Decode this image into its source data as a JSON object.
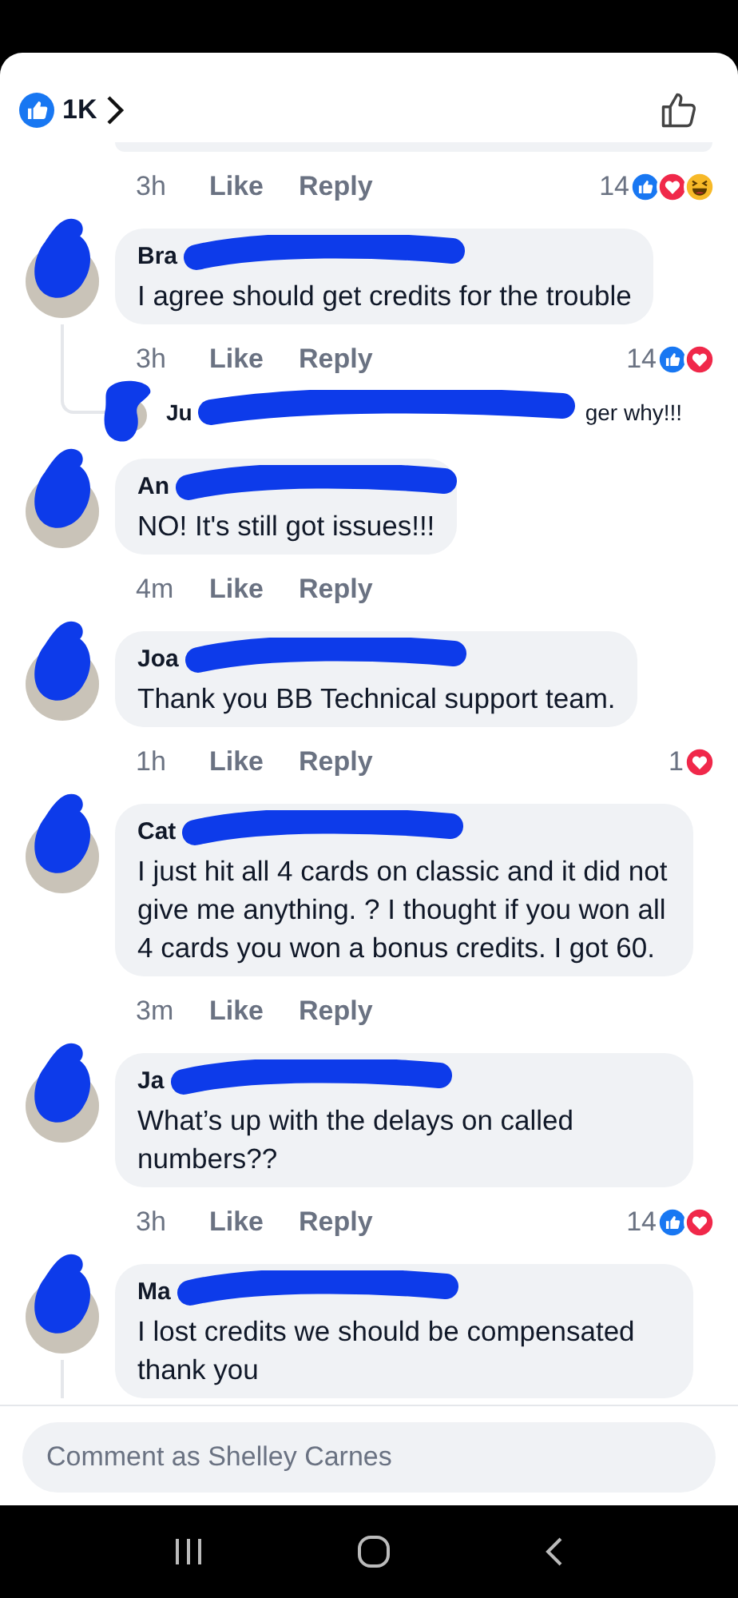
{
  "header": {
    "like_count": "1K"
  },
  "comment_field": {
    "placeholder": "Comment as Shelley Carnes"
  },
  "thread": [
    {
      "kind": "cut_bubble"
    },
    {
      "kind": "actions",
      "time": "3h",
      "like": "Like",
      "reply": "Reply",
      "count": "14",
      "reactions": [
        {
          "kind": "like"
        },
        {
          "kind": "love"
        },
        {
          "kind": "haha"
        }
      ]
    },
    {
      "kind": "comment",
      "name": "Bra",
      "text": "I agree should get credits for the trouble",
      "thread_line": false
    },
    {
      "kind": "actions",
      "time": "3h",
      "like": "Like",
      "reply": "Reply",
      "count": "14",
      "reactions": [
        {
          "kind": "like"
        },
        {
          "kind": "love"
        }
      ]
    },
    {
      "kind": "reply_preview",
      "name": "Ju",
      "text": "ger why!!!"
    },
    {
      "kind": "comment",
      "name": "An",
      "text": "NO! It's still got issues!!!",
      "thread_line": false
    },
    {
      "kind": "actions",
      "time": "4m",
      "like": "Like",
      "reply": "Reply"
    },
    {
      "kind": "comment",
      "name": "Joa",
      "text": "Thank you BB Technical support team.",
      "thread_line": false
    },
    {
      "kind": "actions",
      "time": "1h",
      "like": "Like",
      "reply": "Reply",
      "count": "1",
      "reactions": [
        {
          "kind": "love"
        }
      ]
    },
    {
      "kind": "comment",
      "name": "Cat",
      "text": "I just hit all 4 cards on classic and it did not give me anything. ? I thought if you won all 4 cards you won a bonus credits. I got 60.",
      "thread_line": false
    },
    {
      "kind": "actions",
      "time": "3m",
      "like": "Like",
      "reply": "Reply"
    },
    {
      "kind": "comment",
      "name": "Ja",
      "text": "What’s up with the delays on called numbers??",
      "thread_line": false
    },
    {
      "kind": "actions",
      "time": "3h",
      "like": "Like",
      "reply": "Reply",
      "count": "14",
      "reactions": [
        {
          "kind": "like"
        },
        {
          "kind": "love"
        }
      ]
    },
    {
      "kind": "comment",
      "name": "Ma",
      "text": "I lost credits we should be compensated thank you",
      "thread_line": true
    }
  ]
}
